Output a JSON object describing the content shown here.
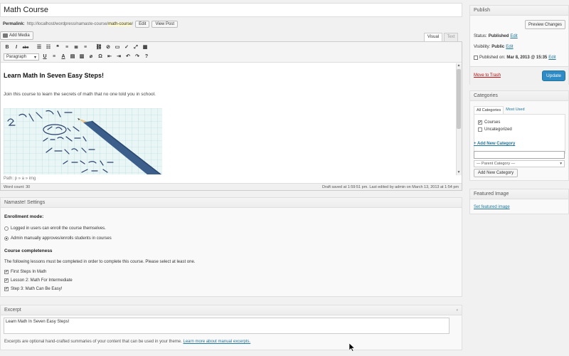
{
  "post": {
    "title": "Math Course",
    "permalink_label": "Permalink:",
    "permalink_base": "http://localhost/wordpress/namaste-course/",
    "permalink_slug": "math-course",
    "permalink_end": "/",
    "edit_label": "Edit",
    "view_label": "View Post"
  },
  "editor": {
    "add_media": "Add Media",
    "tab_visual": "Visual",
    "tab_text": "Text",
    "format_select": "Paragraph",
    "heading": "Learn Math In Seven Easy Steps!",
    "paragraph": "Join this course to learn the secrets of math that no one told you in school.",
    "path": "Path: p » a » img",
    "word_count": "Word count: 30",
    "draft_status": "Draft saved at 1:59:51 pm. Last edited by admin on March 13, 2013 at 1:54 pm"
  },
  "namaste": {
    "title": "Namaste! Settings",
    "enrollment_label": "Enrollment mode:",
    "enroll_options": [
      "Logged in users can enroll the course themselves.",
      "Admin manually approves/enrolls students in courses"
    ],
    "enroll_selected": 1,
    "completeness_label": "Course completeness",
    "completeness_help": "The following lessons must be completed in order to complete this course. Please select at least one.",
    "lessons": [
      {
        "label": "First Steps In Math",
        "checked": true
      },
      {
        "label": "Lesson 2: Math For Intermediate",
        "checked": true
      },
      {
        "label": "Step 3: Math Can Be Easy!",
        "checked": true
      }
    ]
  },
  "excerpt": {
    "title": "Excerpt",
    "value": "Learn Math In Seven Easy Steps!",
    "help": "Excerpts are optional hand-crafted summaries of your content that can be used in your theme.",
    "help_link": "Learn more about manual excerpts."
  },
  "publish": {
    "title": "Publish",
    "preview_label": "Preview Changes",
    "status_label": "Status:",
    "status_value": "Published",
    "visibility_label": "Visibility:",
    "visibility_value": "Public",
    "published_label": "Published on:",
    "published_value": "Mar 8, 2013 @ 15:35",
    "edit_label": "Edit",
    "trash_label": "Move to Trash",
    "update_label": "Update"
  },
  "categories": {
    "title": "Categories",
    "tab_all": "All Categories",
    "tab_used": "Most Used",
    "items": [
      {
        "label": "Courses",
        "checked": true
      },
      {
        "label": "Uncategorized",
        "checked": false
      }
    ],
    "add_link": "+ Add New Category",
    "parent_placeholder": "— Parent Category —",
    "add_button": "Add New Category"
  },
  "featured": {
    "title": "Featured Image",
    "link": "Set featured image"
  },
  "colors": {
    "primary_button": "#2e8bc6",
    "link": "#21759b",
    "trash": "#bc0b0b"
  }
}
